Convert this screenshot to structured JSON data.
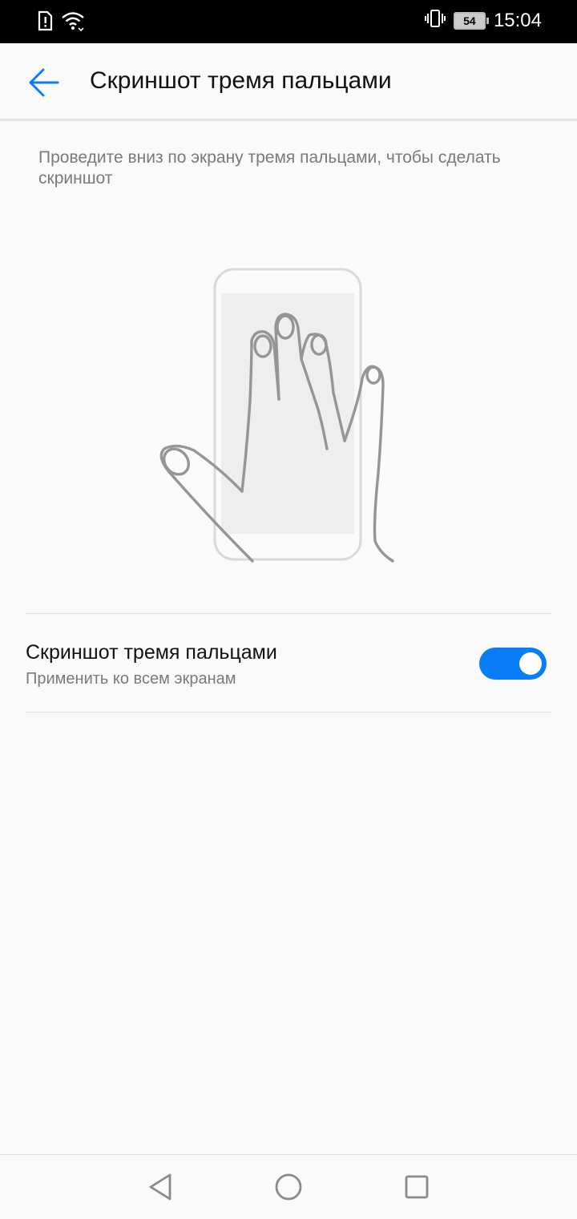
{
  "status_bar": {
    "time": "15:04",
    "battery_level": "54",
    "icons": [
      "sim-alert-icon",
      "wifi-icon",
      "vibrate-icon",
      "battery-icon"
    ]
  },
  "header": {
    "title": "Скриншот тремя пальцами",
    "back_icon": "arrow-left-icon"
  },
  "main": {
    "description": "Проведите вниз по экрану тремя пальцами, чтобы сделать скриншот",
    "setting": {
      "title": "Скриншот тремя пальцами",
      "subtitle": "Применить ко всем экранам",
      "enabled": true
    }
  },
  "nav_bar": {
    "buttons": [
      "back-triangle-icon",
      "home-circle-icon",
      "recents-square-icon"
    ]
  },
  "colors": {
    "accent": "#0a7cf6",
    "status_bar_bg": "#000000",
    "background": "#fafafa"
  }
}
